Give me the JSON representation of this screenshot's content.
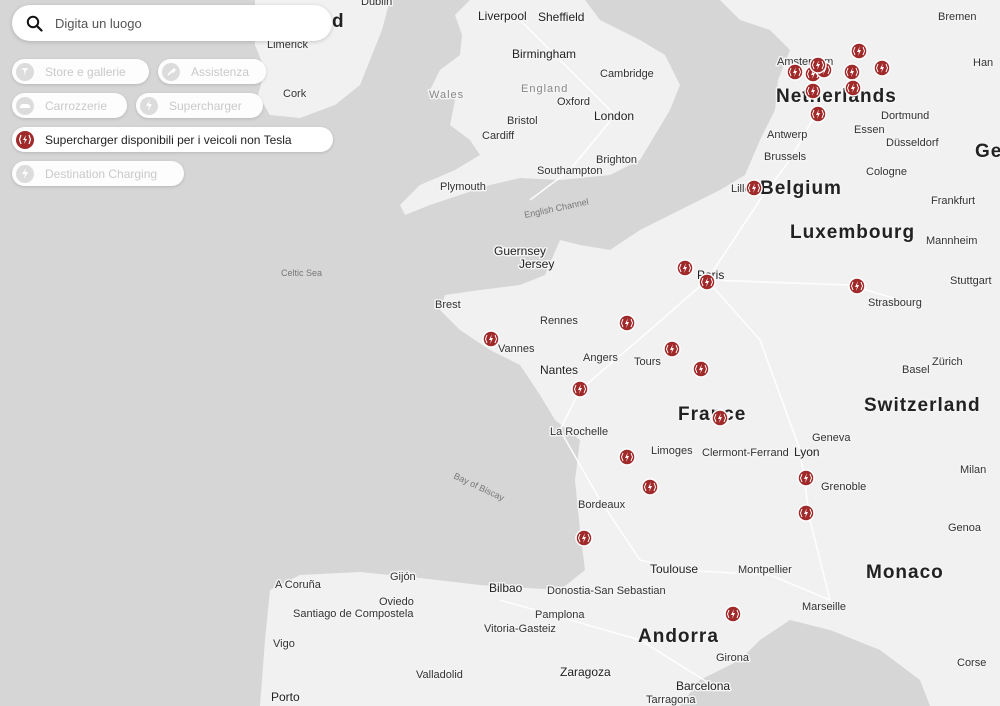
{
  "search": {
    "placeholder": "Digita un luogo"
  },
  "filters": [
    {
      "label": "Store e gallerie",
      "icon": "tesla-logo-icon",
      "active": false
    },
    {
      "label": "Assistenza",
      "icon": "wrench-icon",
      "active": false
    },
    {
      "label": "Carrozzerie",
      "icon": "car-body-icon",
      "active": false
    },
    {
      "label": "Supercharger",
      "icon": "bolt-icon",
      "active": false
    },
    {
      "label": "Supercharger disponibili per i veicoli non Tesla",
      "icon": "supercharger-bolt-icon",
      "active": true
    },
    {
      "label": "Destination Charging",
      "icon": "bolt-icon",
      "active": false
    }
  ],
  "map": {
    "countries": [
      "Netherlands",
      "Belgium",
      "Luxembourg",
      "France",
      "Switzerland",
      "Monaco",
      "Andorra"
    ],
    "cities": [
      "Liverpool",
      "Sheffield",
      "Dublin",
      "Limerick",
      "Cork",
      "Birmingham",
      "Cambridge",
      "England",
      "Wales",
      "Oxford",
      "Bristol",
      "London",
      "Cardiff",
      "Brighton",
      "Southampton",
      "Plymouth",
      "Guernsey",
      "Jersey",
      "Brest",
      "Rennes",
      "Vannes",
      "Angers",
      "Tours",
      "Nantes",
      "Paris",
      "La Rochelle",
      "Limoges",
      "Clermont-Ferrand",
      "Lyon",
      "Geneva",
      "Grenoble",
      "Bordeaux",
      "Toulouse",
      "Montpellier",
      "Marseille",
      "Genoa",
      "Milan",
      "Zürich",
      "Basel",
      "Strasbourg",
      "Stuttgart",
      "Mannheim",
      "Frankfurt",
      "Cologne",
      "Düsseldorf",
      "Essen",
      "Dortmund",
      "Amsterdam",
      "Antwerp",
      "Brussels",
      "Lille",
      "Bremen",
      "Bilbao",
      "Donostia-San Sebastian",
      "Pamplona",
      "Vitoria-Gasteiz",
      "Gijón",
      "Oviedo",
      "A Coruña",
      "Santiago de Compostela",
      "Vigo",
      "Porto",
      "Valladolid",
      "Zaragoza",
      "Barcelona",
      "Girona",
      "Tarragona",
      "Corse",
      "Ge",
      "Han",
      "d"
    ],
    "seas": [
      "Celtic Sea",
      "English Channel",
      "Bay of Biscay"
    ],
    "charger_count": 30
  },
  "colors": {
    "accent": "#a0292a",
    "land": "#f2f2f2",
    "water": "#d7d7d7"
  }
}
